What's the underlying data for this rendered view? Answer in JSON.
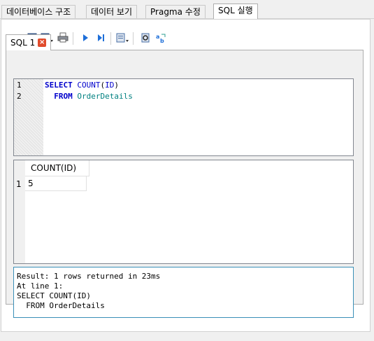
{
  "tabs": [
    "데이터베이스 구조",
    "데이터 보기",
    "Pragma 수정",
    "SQL 실행"
  ],
  "active_tab": "SQL 실행",
  "toolbar": {
    "buttons": [
      "open-tab-icon",
      "open-sql-icon",
      "save-sql-icon",
      "print-icon",
      "execute-all-icon",
      "execute-line-icon",
      "save-results-icon",
      "find-icon",
      "find-replace-icon"
    ]
  },
  "sql_tab": {
    "label": "SQL 1",
    "close": "×"
  },
  "editor": {
    "line_numbers": [
      "1",
      "2"
    ],
    "line1": {
      "kw": "SELECT",
      "fn": "COUNT",
      "open": "(",
      "arg": "ID",
      "close": ")"
    },
    "line2": {
      "kw": "FROM",
      "table": "OrderDetails"
    }
  },
  "results": {
    "columns": [
      "COUNT(ID)"
    ],
    "rows": [
      {
        "num": "1",
        "values": [
          "5"
        ]
      }
    ]
  },
  "message": {
    "lines": [
      "Result: 1 rows returned in 23ms",
      "At line 1:",
      "SELECT COUNT(ID)",
      "  FROM OrderDetails"
    ]
  },
  "colors": {
    "keyword": "#0000cc",
    "identifier": "#008080",
    "message_border": "#3a8fb7",
    "close_button": "#e04b2c"
  }
}
